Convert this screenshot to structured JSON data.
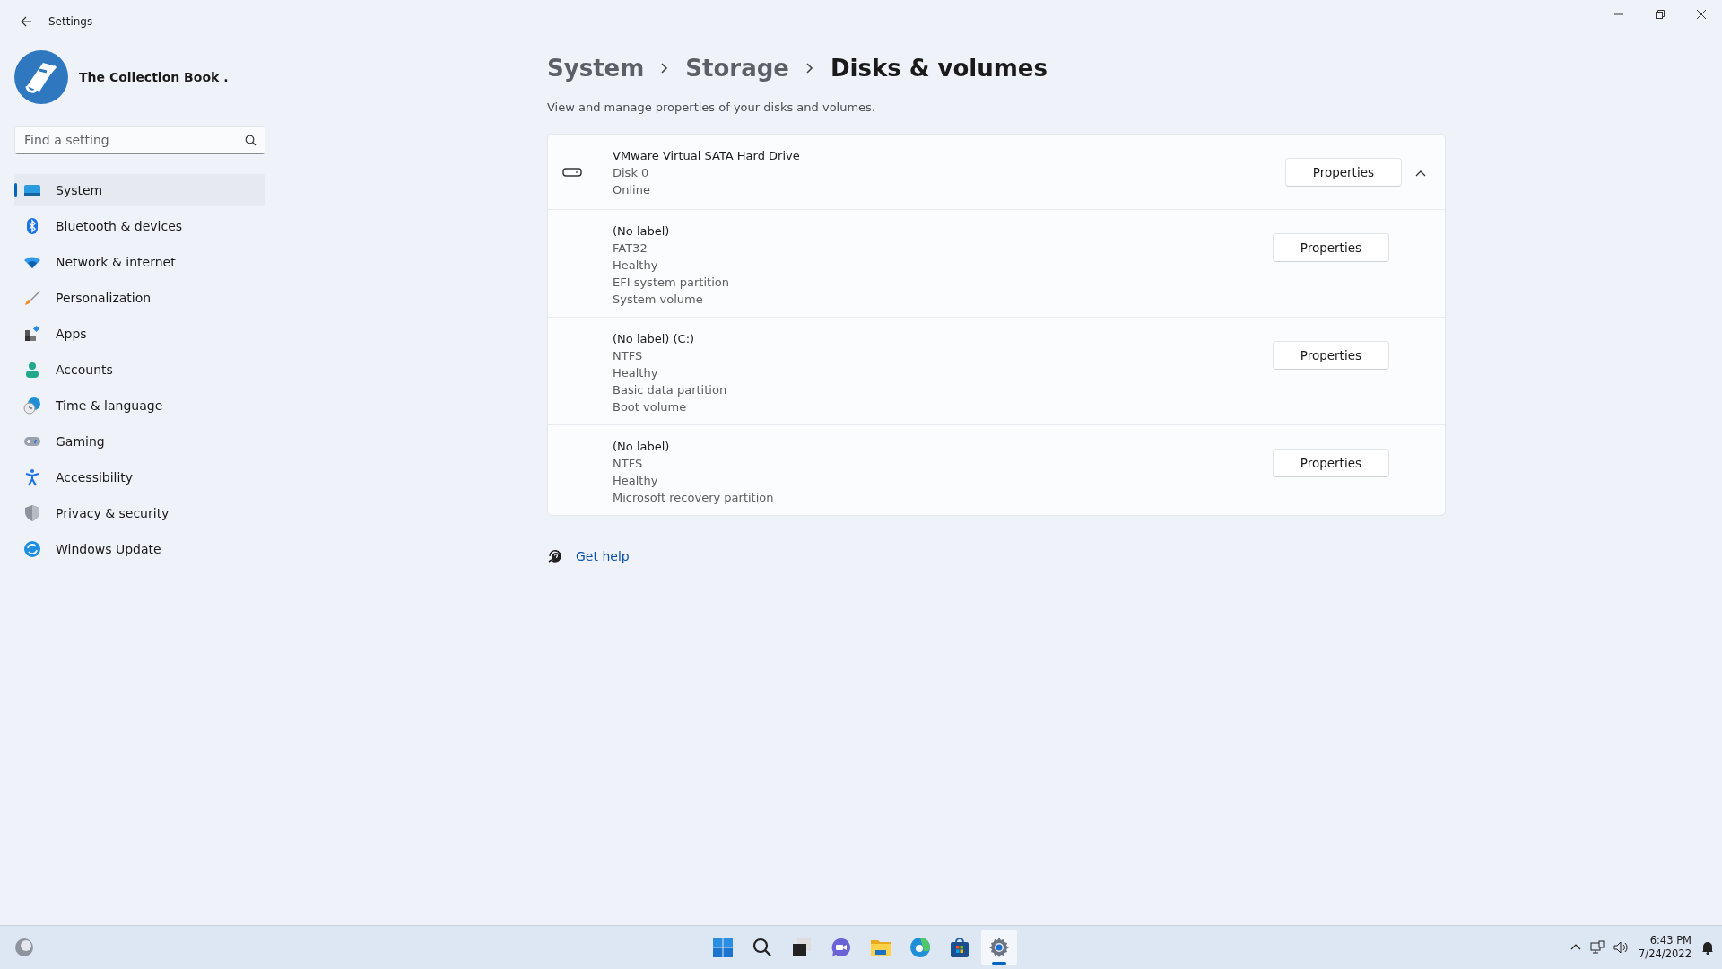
{
  "window": {
    "title": "Settings"
  },
  "profile": {
    "name": "The Collection Book ."
  },
  "search": {
    "placeholder": "Find a setting"
  },
  "nav": [
    {
      "label": "System",
      "selected": true
    },
    {
      "label": "Bluetooth & devices",
      "selected": false
    },
    {
      "label": "Network & internet",
      "selected": false
    },
    {
      "label": "Personalization",
      "selected": false
    },
    {
      "label": "Apps",
      "selected": false
    },
    {
      "label": "Accounts",
      "selected": false
    },
    {
      "label": "Time & language",
      "selected": false
    },
    {
      "label": "Gaming",
      "selected": false
    },
    {
      "label": "Accessibility",
      "selected": false
    },
    {
      "label": "Privacy & security",
      "selected": false
    },
    {
      "label": "Windows Update",
      "selected": false
    }
  ],
  "breadcrumb": [
    "System",
    "Storage",
    "Disks & volumes"
  ],
  "description": "View and manage properties of your disks and volumes.",
  "disk": {
    "name": "VMware Virtual SATA Hard Drive",
    "lines": [
      "Disk 0",
      "Online"
    ],
    "button": "Properties",
    "expanded": true
  },
  "volumes": [
    {
      "title": "(No label)",
      "lines": [
        "FAT32",
        "Healthy",
        "EFI system partition",
        "System volume"
      ],
      "button": "Properties"
    },
    {
      "title": "(No label) (C:)",
      "lines": [
        "NTFS",
        "Healthy",
        "Basic data partition",
        "Boot volume"
      ],
      "button": "Properties"
    },
    {
      "title": "(No label)",
      "lines": [
        "NTFS",
        "Healthy",
        "Microsoft recovery partition"
      ],
      "button": "Properties"
    }
  ],
  "help": {
    "label": "Get help"
  },
  "taskbar": {
    "apps": [
      {
        "selected": false
      },
      {
        "selected": false
      },
      {
        "selected": false
      },
      {
        "selected": false
      },
      {
        "selected": false
      },
      {
        "selected": false
      },
      {
        "selected": false
      },
      {
        "selected": true
      }
    ],
    "clock": {
      "time": "6:43 PM",
      "date": "7/24/2022"
    }
  }
}
